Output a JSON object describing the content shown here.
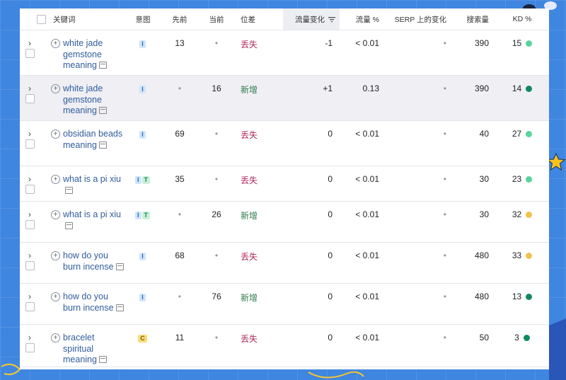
{
  "columns": {
    "keyword": "关键词",
    "intent": "意图",
    "previous": "先前",
    "current": "当前",
    "position_diff": "位差",
    "traffic_change": "流量变化",
    "traffic_pct": "流量 %",
    "serp_change": "SERP 上的变化",
    "volume": "搜索量",
    "kd": "KD %"
  },
  "rows": [
    {
      "keyword": "white jade gemstone meaning",
      "intents": [
        "I"
      ],
      "previous": "13",
      "current": "•",
      "diff": "丢失",
      "diff_type": "lost",
      "traffic_change": "-1",
      "traffic_pct": "< 0.01",
      "serp": "•",
      "volume": "390",
      "kd": "15",
      "kd_color": "#5ad39b",
      "highlight": false
    },
    {
      "keyword": "white jade gemstone meaning",
      "intents": [
        "I"
      ],
      "previous": "•",
      "current": "16",
      "diff": "新增",
      "diff_type": "new",
      "traffic_change": "+1",
      "traffic_pct": "0.13",
      "serp": "•",
      "volume": "390",
      "kd": "14",
      "kd_color": "#0f8a5f",
      "highlight": true
    },
    {
      "keyword": "obsidian beads meaning",
      "intents": [
        "I"
      ],
      "previous": "69",
      "current": "•",
      "diff": "丢失",
      "diff_type": "lost",
      "traffic_change": "0",
      "traffic_pct": "< 0.01",
      "serp": "•",
      "volume": "40",
      "kd": "27",
      "kd_color": "#5ad39b",
      "highlight": false
    },
    {
      "keyword": "what is a pi xiu",
      "intents": [
        "I",
        "T"
      ],
      "previous": "35",
      "current": "•",
      "diff": "丢失",
      "diff_type": "lost",
      "traffic_change": "0",
      "traffic_pct": "< 0.01",
      "serp": "•",
      "volume": "30",
      "kd": "23",
      "kd_color": "#5ad39b",
      "highlight": false
    },
    {
      "keyword": "what is a pi xiu",
      "intents": [
        "I",
        "T"
      ],
      "previous": "•",
      "current": "26",
      "diff": "新增",
      "diff_type": "new",
      "traffic_change": "0",
      "traffic_pct": "< 0.01",
      "serp": "•",
      "volume": "30",
      "kd": "32",
      "kd_color": "#f2c14e",
      "highlight": false
    },
    {
      "keyword": "how do you burn incense",
      "intents": [
        "I"
      ],
      "previous": "68",
      "current": "•",
      "diff": "丢失",
      "diff_type": "lost",
      "traffic_change": "0",
      "traffic_pct": "< 0.01",
      "serp": "•",
      "volume": "480",
      "kd": "33",
      "kd_color": "#f2c14e",
      "highlight": false
    },
    {
      "keyword": "how do you burn incense",
      "intents": [
        "I"
      ],
      "previous": "•",
      "current": "76",
      "diff": "新增",
      "diff_type": "new",
      "traffic_change": "0",
      "traffic_pct": "< 0.01",
      "serp": "•",
      "volume": "480",
      "kd": "13",
      "kd_color": "#0f8a5f",
      "highlight": false
    },
    {
      "keyword": "bracelet spiritual meaning",
      "intents": [
        "C"
      ],
      "previous": "11",
      "current": "•",
      "diff": "丢失",
      "diff_type": "lost",
      "traffic_change": "0",
      "traffic_pct": "< 0.01",
      "serp": "•",
      "volume": "50",
      "kd": "3",
      "kd_color": "#0f8a5f",
      "highlight": false
    }
  ]
}
